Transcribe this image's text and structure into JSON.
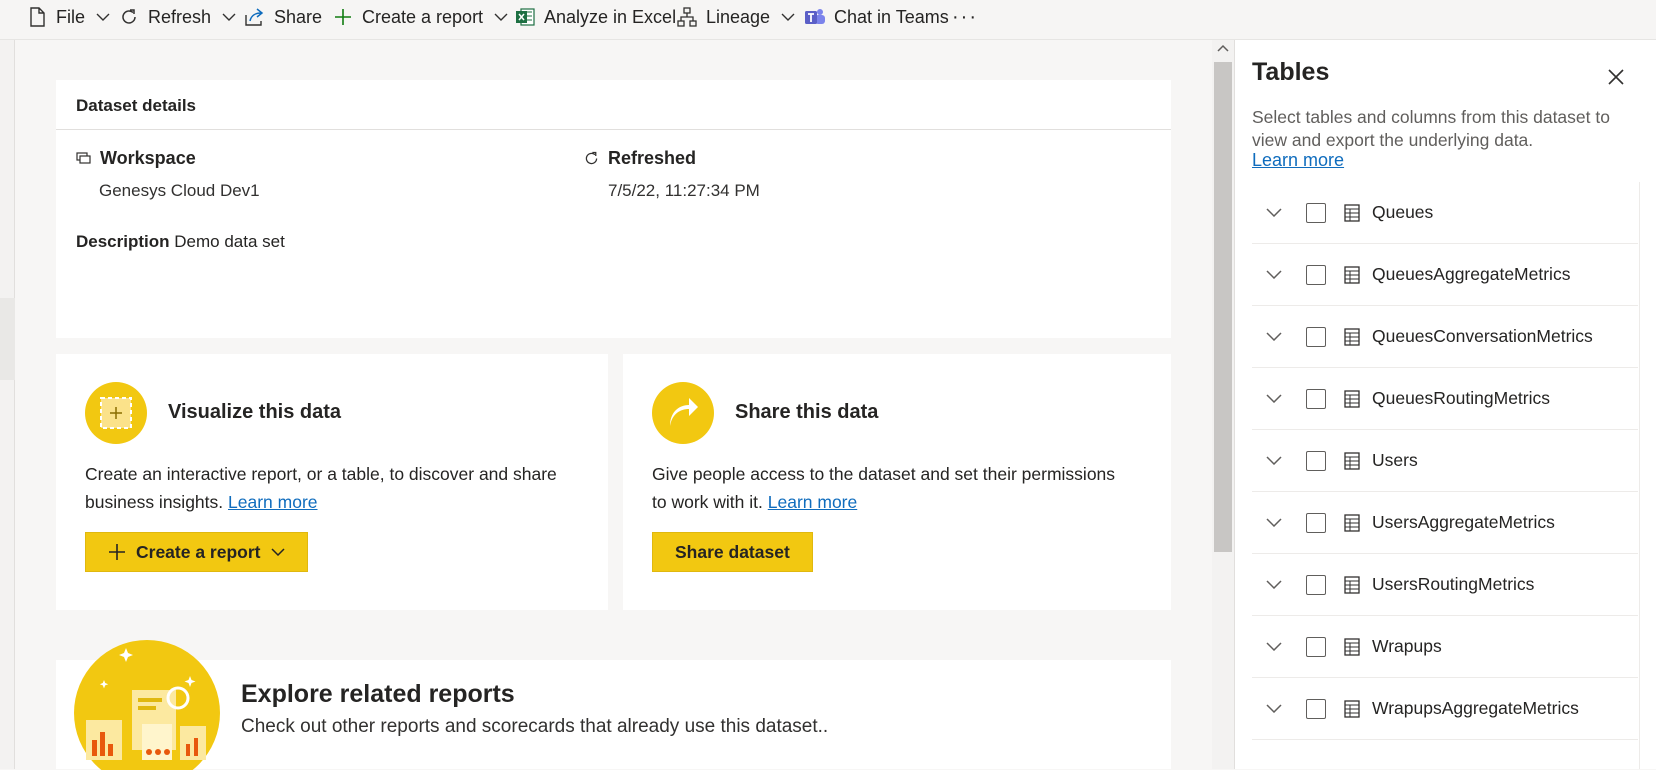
{
  "toolbar": {
    "file": "File",
    "refresh": "Refresh",
    "share": "Share",
    "create_report": "Create a report",
    "analyze_excel": "Analyze in Excel",
    "lineage": "Lineage",
    "chat_teams": "Chat in Teams",
    "more": "···"
  },
  "details": {
    "header": "Dataset details",
    "workspace_label": "Workspace",
    "workspace_value": "Genesys Cloud Dev1",
    "refreshed_label": "Refreshed",
    "refreshed_value": "7/5/22, 11:27:34 PM",
    "description_label": "Description",
    "description_value": "Demo data set"
  },
  "visualize": {
    "title": "Visualize this data",
    "text": "Create an interactive report, or a table, to discover and share business insights.",
    "link": "Learn more",
    "button": "Create a report"
  },
  "share_card": {
    "title": "Share this data",
    "text": "Give people access to the dataset and set their permissions to work with it.",
    "link": "Learn more",
    "button": "Share dataset"
  },
  "explore": {
    "title": "Explore related reports",
    "subtitle": "Check out other reports and scorecards that already use this dataset.."
  },
  "panel": {
    "title": "Tables",
    "description": "Select tables and columns from this dataset to view and export the underlying data.",
    "link": "Learn more",
    "tables": [
      {
        "name": "Queues"
      },
      {
        "name": "QueuesAggregateMetrics"
      },
      {
        "name": "QueuesConversationMetrics"
      },
      {
        "name": "QueuesRoutingMetrics"
      },
      {
        "name": "Users"
      },
      {
        "name": "UsersAggregateMetrics"
      },
      {
        "name": "UsersRoutingMetrics"
      },
      {
        "name": "Wrapups"
      },
      {
        "name": "WrapupsAggregateMetrics"
      }
    ]
  },
  "colors": {
    "accent_yellow": "#f2c811",
    "link_blue": "#0f6cbd",
    "excel_green": "#1d6f42",
    "teams_purple": "#5b5fc7"
  }
}
